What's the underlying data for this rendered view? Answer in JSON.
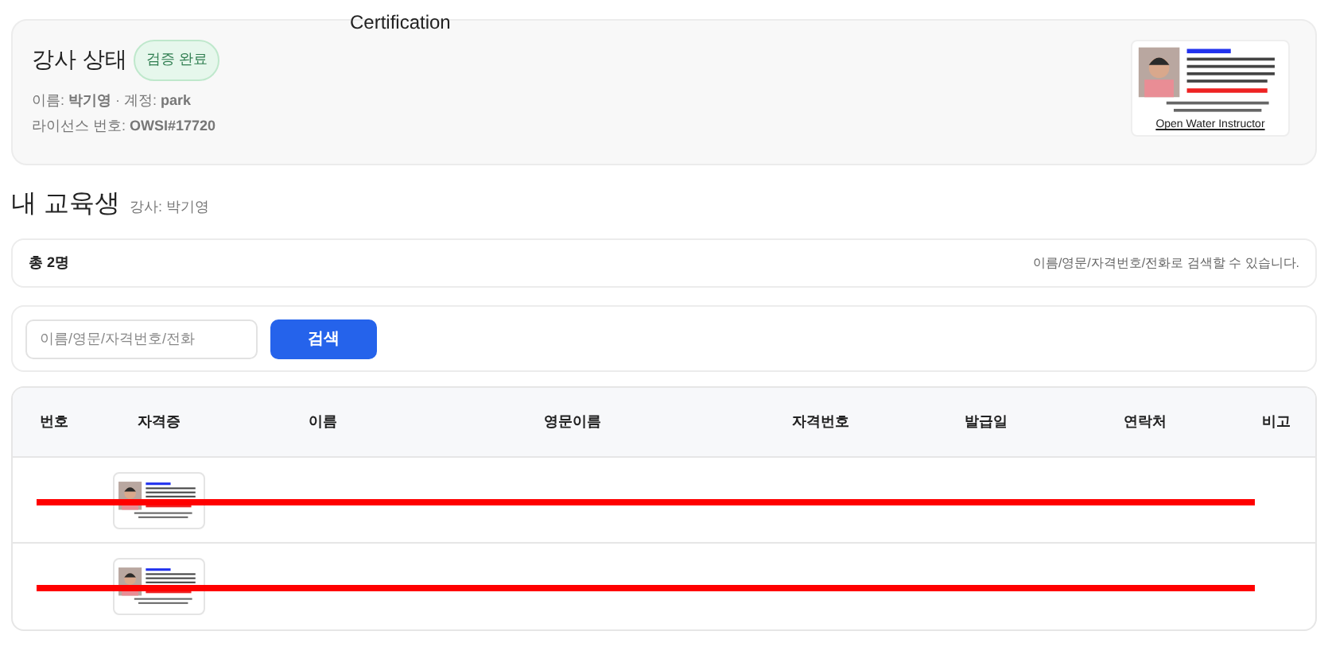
{
  "certification_label": "Certification",
  "instructor": {
    "title": "강사 상태",
    "badge": "검증 완료",
    "account_line": "이름: **박기영** · 계정: **park**",
    "license_line": "라이선스 번호: **OWSI#17720**",
    "card": {
      "title": "Open Water Instructor"
    }
  },
  "students": {
    "title": "내 교육생",
    "subtitle": "강사: 박기영",
    "total": "총 2명",
    "hint": "이름/영문/자격번호/전화로 검색할 수 있습니다.",
    "search": {
      "placeholder": "이름/영문/자격번호/전화",
      "button": "검색"
    },
    "columns": [
      "번호",
      "자격증",
      "이름",
      "영문이름",
      "자격번호",
      "발급일",
      "연락처",
      "비고"
    ],
    "rows": [
      {
        "redacted": true
      },
      {
        "redacted": true
      }
    ]
  }
}
